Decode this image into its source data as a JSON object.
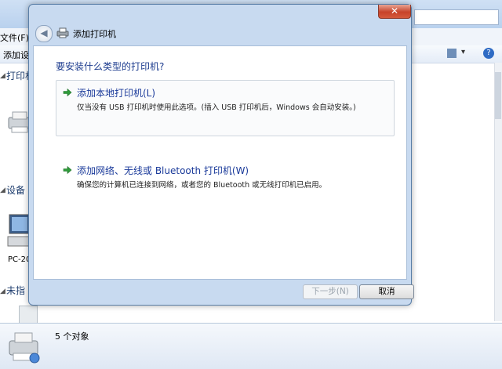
{
  "explorer": {
    "menu_file": "文件(F)",
    "toolbar_add": "添加设",
    "section_printers": "打印机",
    "section_devices": "设备",
    "section_unspecified": "未指",
    "pc_label": "PC-20",
    "details_count": "5 个对象"
  },
  "dialog": {
    "title": "添加打印机",
    "close_glyph": "✕",
    "back_glyph": "◀",
    "heading": "要安装什么类型的打印机?",
    "options": [
      {
        "title": "添加本地打印机(L)",
        "description": "仅当没有 USB 打印机时使用此选项。(插入 USB 打印机后，Windows 会自动安装。)"
      },
      {
        "title": "添加网络、无线或 Bluetooth 打印机(W)",
        "description": "确保您的计算机已连接到网络，或者您的 Bluetooth 或无线打印机已启用。"
      }
    ],
    "next_label": "下一步(N)",
    "cancel_label": "取消"
  },
  "icons": {
    "option_arrow": "green-arrow-icon",
    "dialog_icon": "printer-icon"
  },
  "colors": {
    "heading": "#1e3d8f",
    "option_title": "#1a3a9a",
    "close_button": "#c7432a",
    "arrow": "#2e9c3a"
  }
}
